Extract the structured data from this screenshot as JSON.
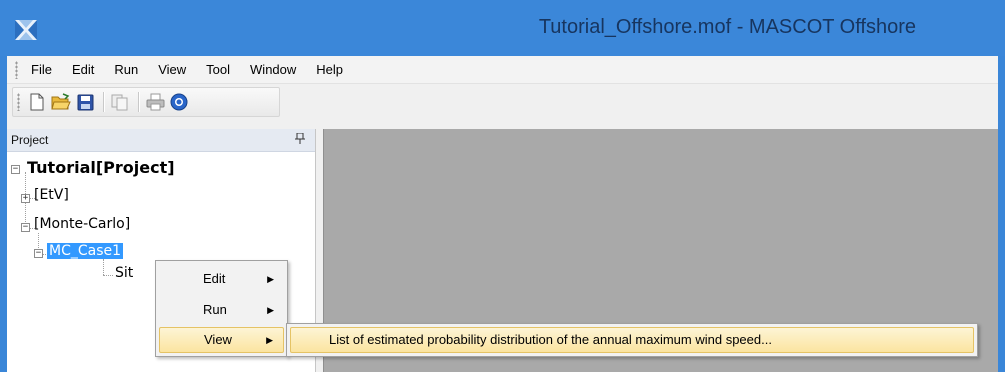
{
  "window": {
    "title": "Tutorial_Offshore.mof - MASCOT Offshore",
    "titlebar_color": "#3b87d9"
  },
  "menubar": {
    "items": [
      {
        "label": "File"
      },
      {
        "label": "Edit"
      },
      {
        "label": "Run"
      },
      {
        "label": "View"
      },
      {
        "label": "Tool"
      },
      {
        "label": "Window"
      },
      {
        "label": "Help"
      }
    ]
  },
  "toolbar": {
    "buttons": [
      {
        "icon": "new-document-icon"
      },
      {
        "icon": "open-folder-icon"
      },
      {
        "icon": "save-icon"
      },
      {
        "icon": "copy-icon"
      },
      {
        "icon": "print-icon"
      },
      {
        "icon": "help-icon"
      }
    ]
  },
  "project_panel": {
    "title": "Project",
    "pin_glyph": "⊕",
    "tree": {
      "root": {
        "label": "Tutorial[Project]",
        "expander": "−"
      },
      "etv": {
        "label": "[EtV]",
        "expander": "+"
      },
      "monte_carlo": {
        "label": "[Monte-Carlo]",
        "expander": "−"
      },
      "mc_case1": {
        "label": "MC_Case1",
        "expander": "−",
        "selected": true
      },
      "site": {
        "label": "Sit"
      }
    }
  },
  "context_menu": {
    "items": [
      {
        "label": "Edit",
        "has_submenu": true
      },
      {
        "label": "Run",
        "has_submenu": true
      },
      {
        "label": "View",
        "has_submenu": true,
        "highlighted": true
      }
    ],
    "arrow_glyph": "▶"
  },
  "submenu": {
    "items": [
      {
        "label": "List of estimated probability distribution of the annual maximum wind speed..."
      }
    ]
  },
  "colors": {
    "selection": "#3399ff",
    "highlight": "#fbe4a0",
    "workspace": "#a9a9a9"
  }
}
